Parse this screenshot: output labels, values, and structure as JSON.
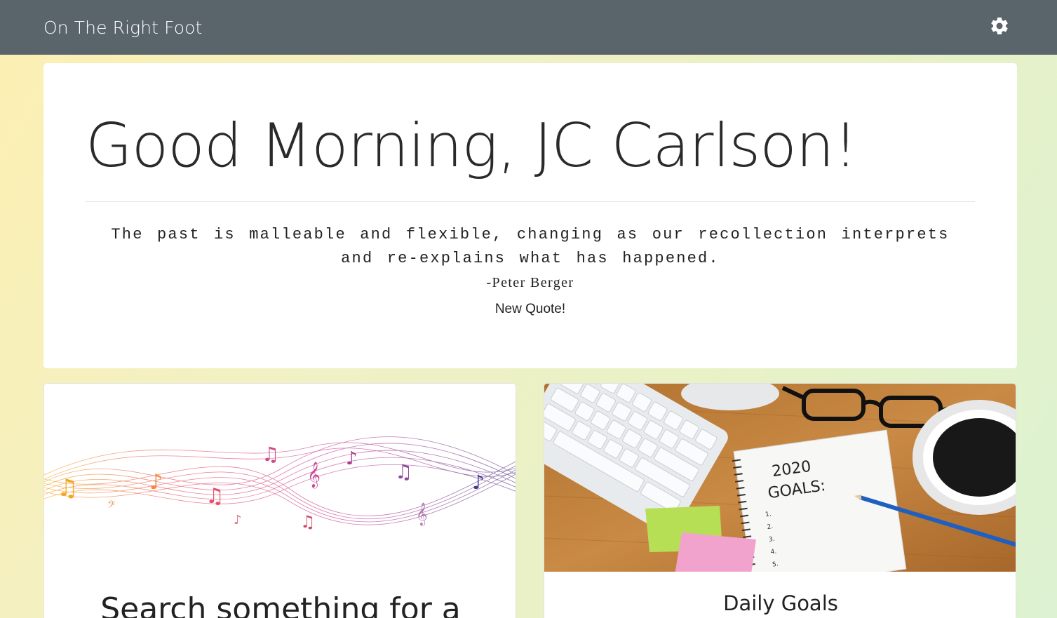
{
  "navbar": {
    "brand": "On The Right Foot",
    "settings_icon": "gear-icon"
  },
  "hero": {
    "greeting": "Good Morning, JC Carlson!",
    "quote_line1": "The past is malleable and flexible, changing as our recollection interprets",
    "quote_line2": "and re-explains what has happened.",
    "author": "-Peter Berger",
    "new_quote_label": "New Quote!"
  },
  "cards": [
    {
      "title": "Search something for a",
      "image": "music-notes-wave-image"
    },
    {
      "title": "Daily Goals",
      "image": "desk-2020-goals-image",
      "notebook_text": "2020 GOALS:"
    }
  ],
  "colors": {
    "navbar": "#5a646b",
    "card_bg": "#ffffff",
    "text": "#222222"
  }
}
